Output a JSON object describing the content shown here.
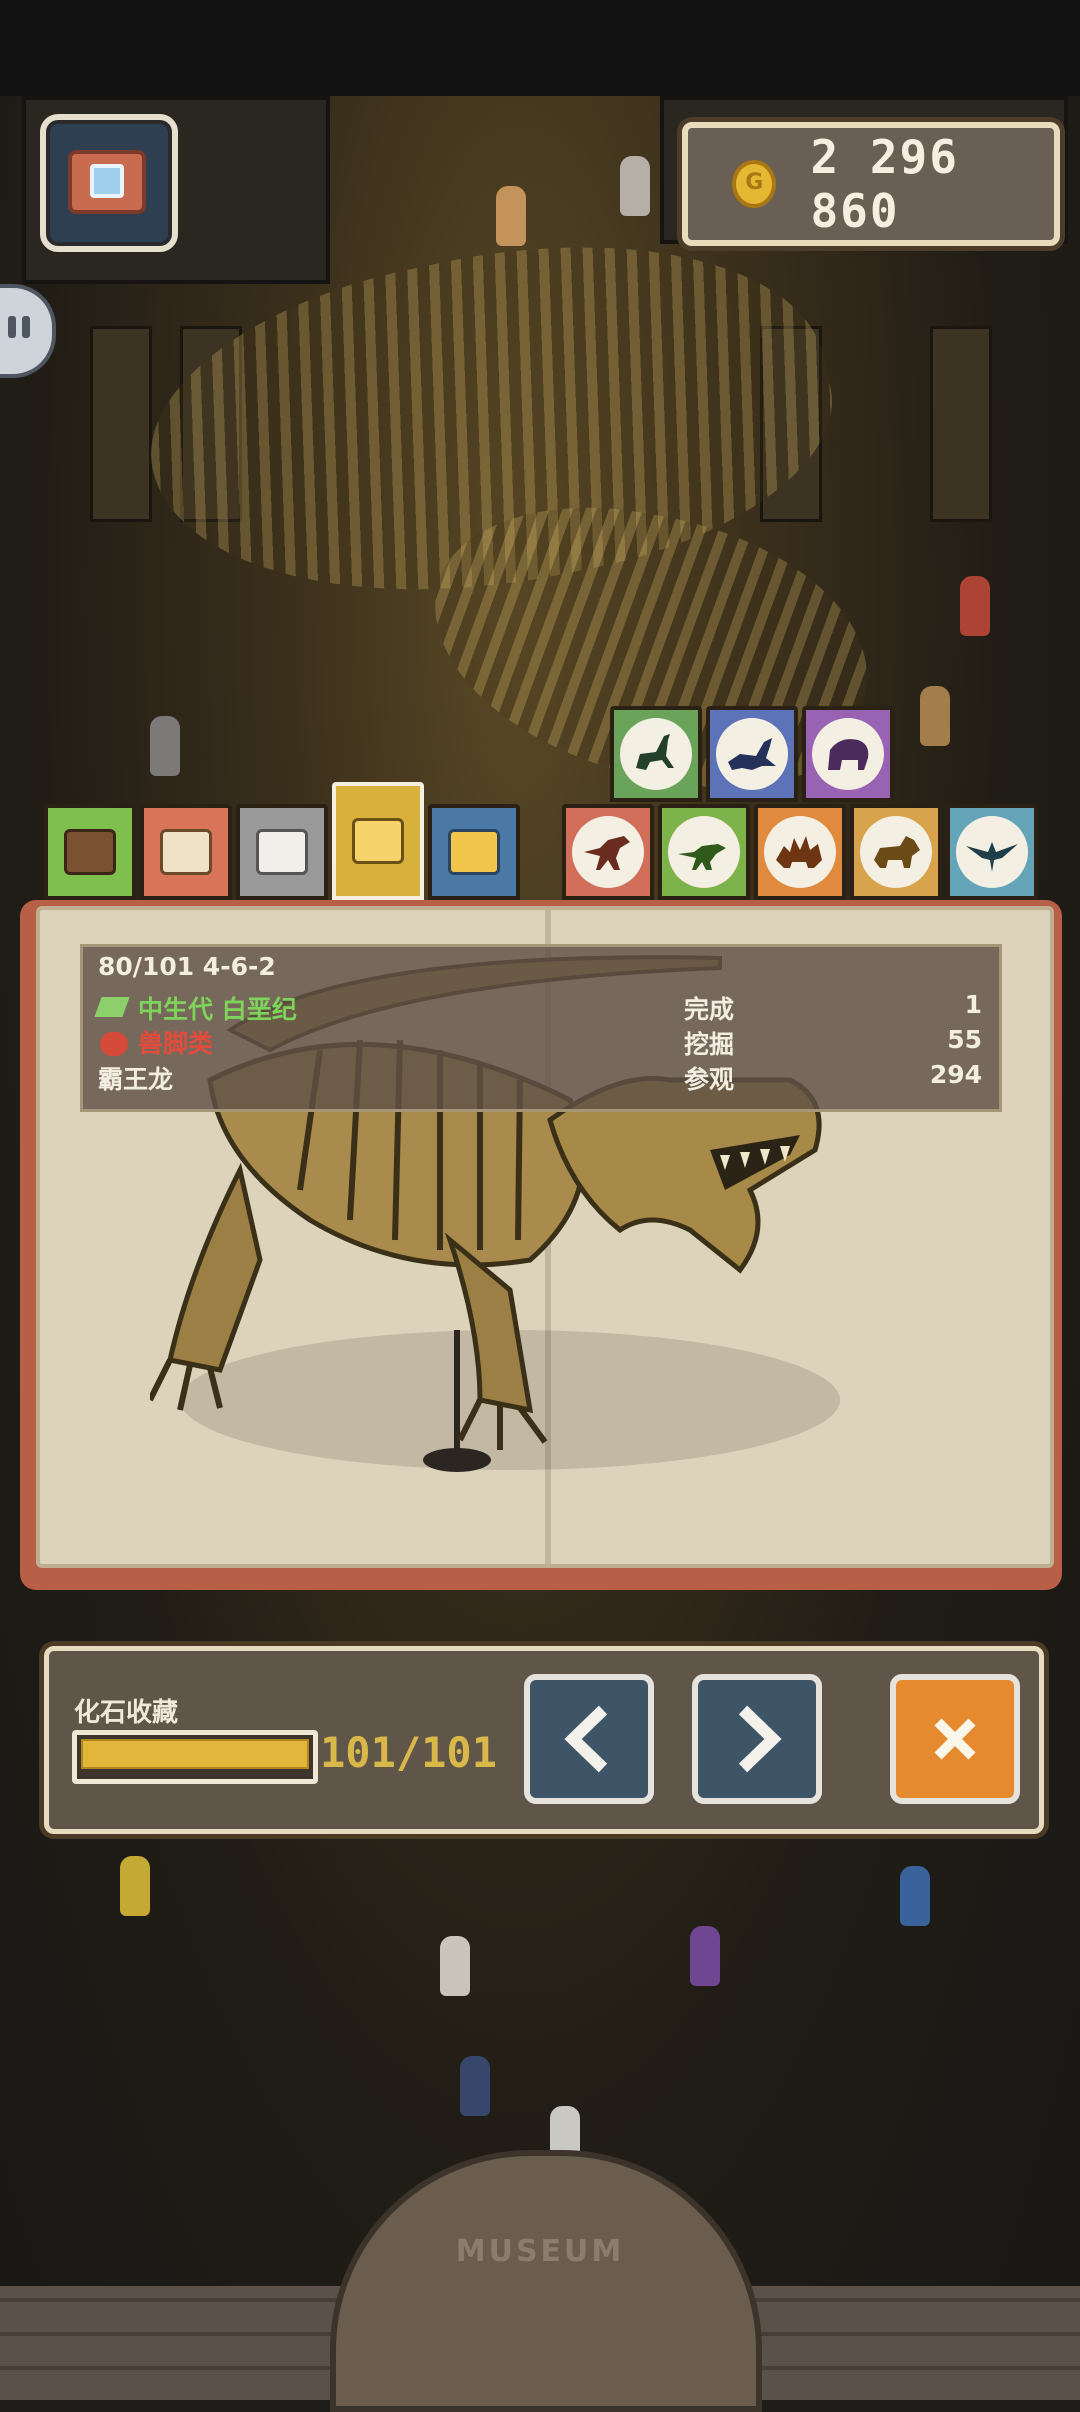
{
  "hud": {
    "coins": "2 296 860",
    "coin_symbol": "G"
  },
  "category_tabs": [
    {
      "name": "tab-barrel",
      "color": "#7fbf4e"
    },
    {
      "name": "tab-brown-crate",
      "color": "#d87458"
    },
    {
      "name": "tab-gray-crate",
      "color": "#9a9a9a"
    },
    {
      "name": "tab-gold-crate",
      "color": "#d8b13c"
    },
    {
      "name": "tab-blue-crate",
      "color": "#4a79a5"
    }
  ],
  "dino_tabs_top": [
    {
      "name": "sauropod",
      "color": "#6aa45a"
    },
    {
      "name": "plesiosaur",
      "color": "#5d73b7"
    },
    {
      "name": "mammoth",
      "color": "#9863b2"
    }
  ],
  "dino_tabs_bottom": [
    {
      "name": "theropod",
      "color": "#d26f5b"
    },
    {
      "name": "raptor",
      "color": "#7db34b"
    },
    {
      "name": "stegosaur",
      "color": "#df8a3e"
    },
    {
      "name": "triceratops",
      "color": "#d9a34e"
    },
    {
      "name": "pterosaur",
      "color": "#65a4b8"
    }
  ],
  "fossil": {
    "id": "80/101 4-6-2",
    "era": "中生代 白垩纪",
    "class": "兽脚类",
    "name": "霸王龙",
    "stats": [
      {
        "label": "完成",
        "value": "1"
      },
      {
        "label": "挖掘",
        "value": "55"
      },
      {
        "label": "参观",
        "value": "294"
      }
    ]
  },
  "collection": {
    "label": "化石收藏",
    "progress_text": "101/101",
    "progress": 1.0
  },
  "scene": {
    "sign": "MUSEUM"
  },
  "colors": {
    "accent_gold": "#e2b53b",
    "close_orange": "#e58a2f",
    "nav_blue": "#3e5467"
  }
}
